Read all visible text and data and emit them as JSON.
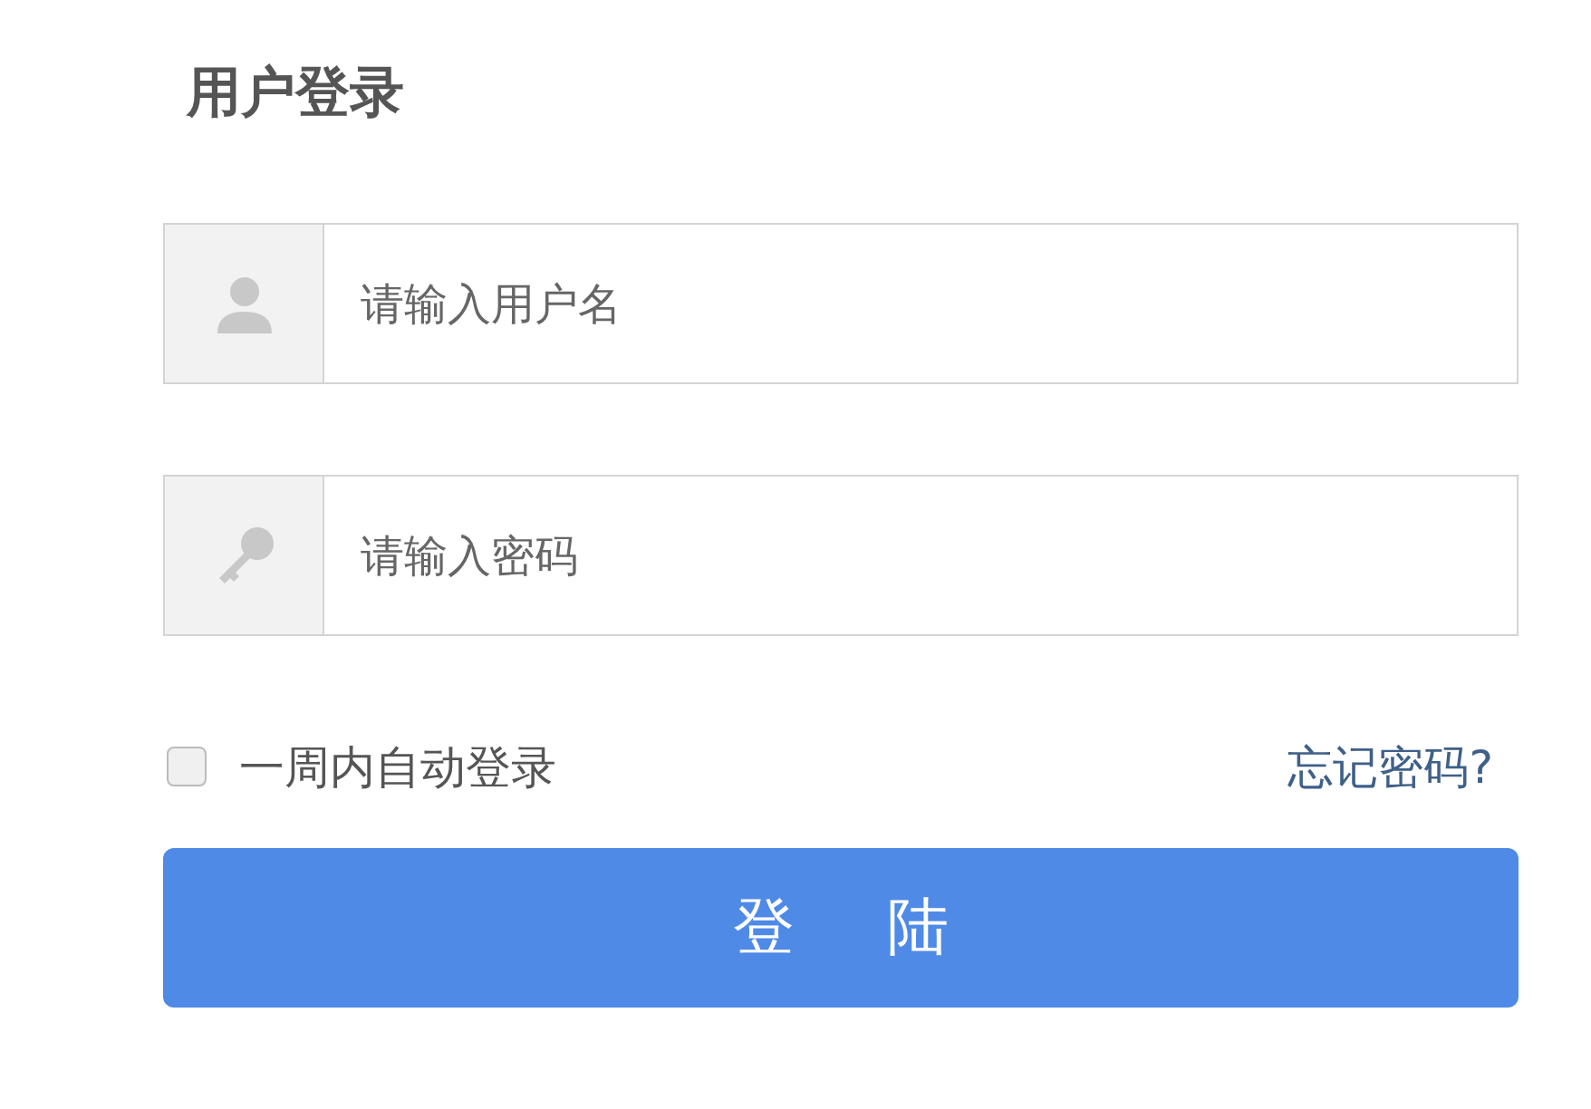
{
  "title": "用户登录",
  "fields": [
    {
      "kind": "user",
      "placeholder": "请输入用户名"
    },
    {
      "kind": "password",
      "placeholder": "请输入密码"
    }
  ],
  "remember": {
    "label": "一周内自动登录",
    "checked": false
  },
  "forgot_link": "忘记密码?",
  "submit_button": "登 陆"
}
